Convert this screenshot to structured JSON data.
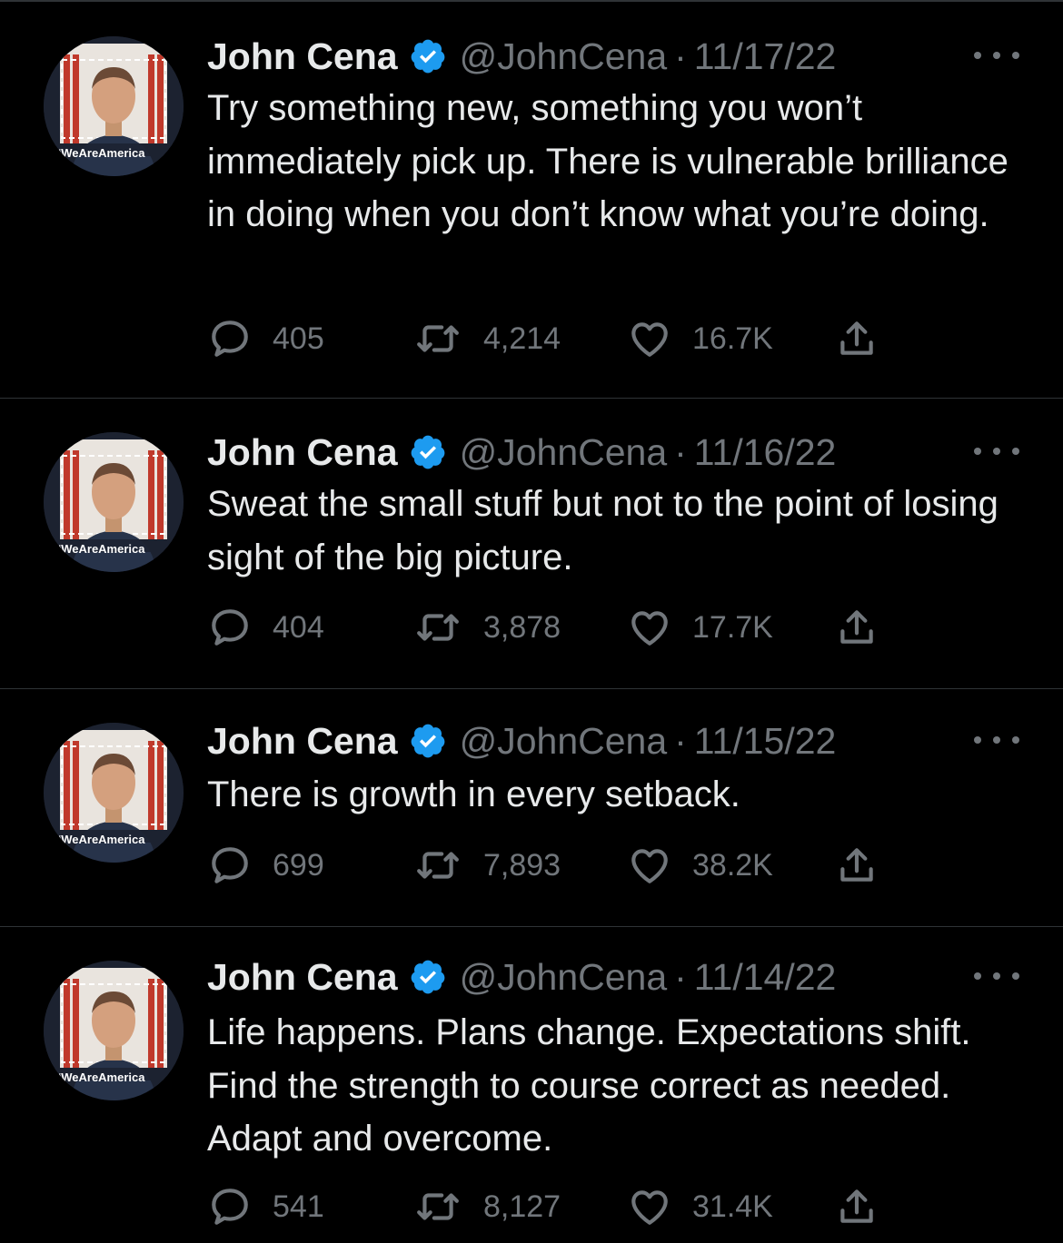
{
  "colors": {
    "background": "#000000",
    "text_primary": "#e7e9ea",
    "text_secondary": "#71767b",
    "divider": "#2f3336",
    "verified_badge": "#1d9bf0"
  },
  "tweets": [
    {
      "name": "John Cena",
      "handle": "@JohnCena",
      "separator": "·",
      "date": "11/17/22",
      "avatar_caption": "#WeAreAmerica",
      "text": "Try something new, something you won’t immediately pick up. There is vulnerable brilliance in doing when you don’t know what you’re doing.",
      "replies": "405",
      "retweets": "4,214",
      "likes": "16.7K"
    },
    {
      "name": "John Cena",
      "handle": "@JohnCena",
      "separator": "·",
      "date": "11/16/22",
      "avatar_caption": "#WeAreAmerica",
      "text": "Sweat the small stuff but not to the point of losing sight of the big picture.",
      "replies": "404",
      "retweets": "3,878",
      "likes": "17.7K"
    },
    {
      "name": "John Cena",
      "handle": "@JohnCena",
      "separator": "·",
      "date": "11/15/22",
      "avatar_caption": "#WeAreAmerica",
      "text": "There is growth in every setback.",
      "replies": "699",
      "retweets": "7,893",
      "likes": "38.2K"
    },
    {
      "name": "John Cena",
      "handle": "@JohnCena",
      "separator": "·",
      "date": "11/14/22",
      "avatar_caption": "#WeAreAmerica",
      "text": "Life happens. Plans change. Expectations shift. Find the strength to course correct as needed. Adapt and overcome.",
      "replies": "541",
      "retweets": "8,127",
      "likes": "31.4K"
    }
  ]
}
